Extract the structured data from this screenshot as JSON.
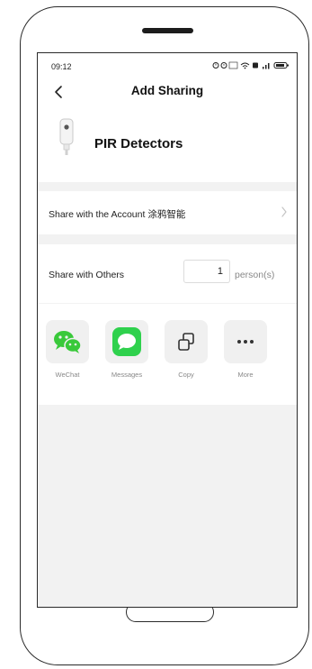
{
  "status_bar": {
    "time": "09:12",
    "icons_text": "⏰ ● ≡ ▣ ᵀ ▐"
  },
  "header": {
    "title": "Add Sharing"
  },
  "device": {
    "name": "PIR Detectors"
  },
  "share_account": {
    "label": "Share with the Account 涂鸦智能"
  },
  "share_others": {
    "label": "Share with Others",
    "count": "1",
    "unit": "person(s)"
  },
  "share_options": [
    {
      "label": "WeChat",
      "icon": "wechat-icon"
    },
    {
      "label": "Messages",
      "icon": "messages-icon"
    },
    {
      "label": "Copy",
      "icon": "copy-icon"
    },
    {
      "label": "More",
      "icon": "more-icon"
    }
  ],
  "colors": {
    "screen_background": "#f2f2f2",
    "wechat_green": "#39c93a",
    "messages_green": "#2fd14d"
  }
}
